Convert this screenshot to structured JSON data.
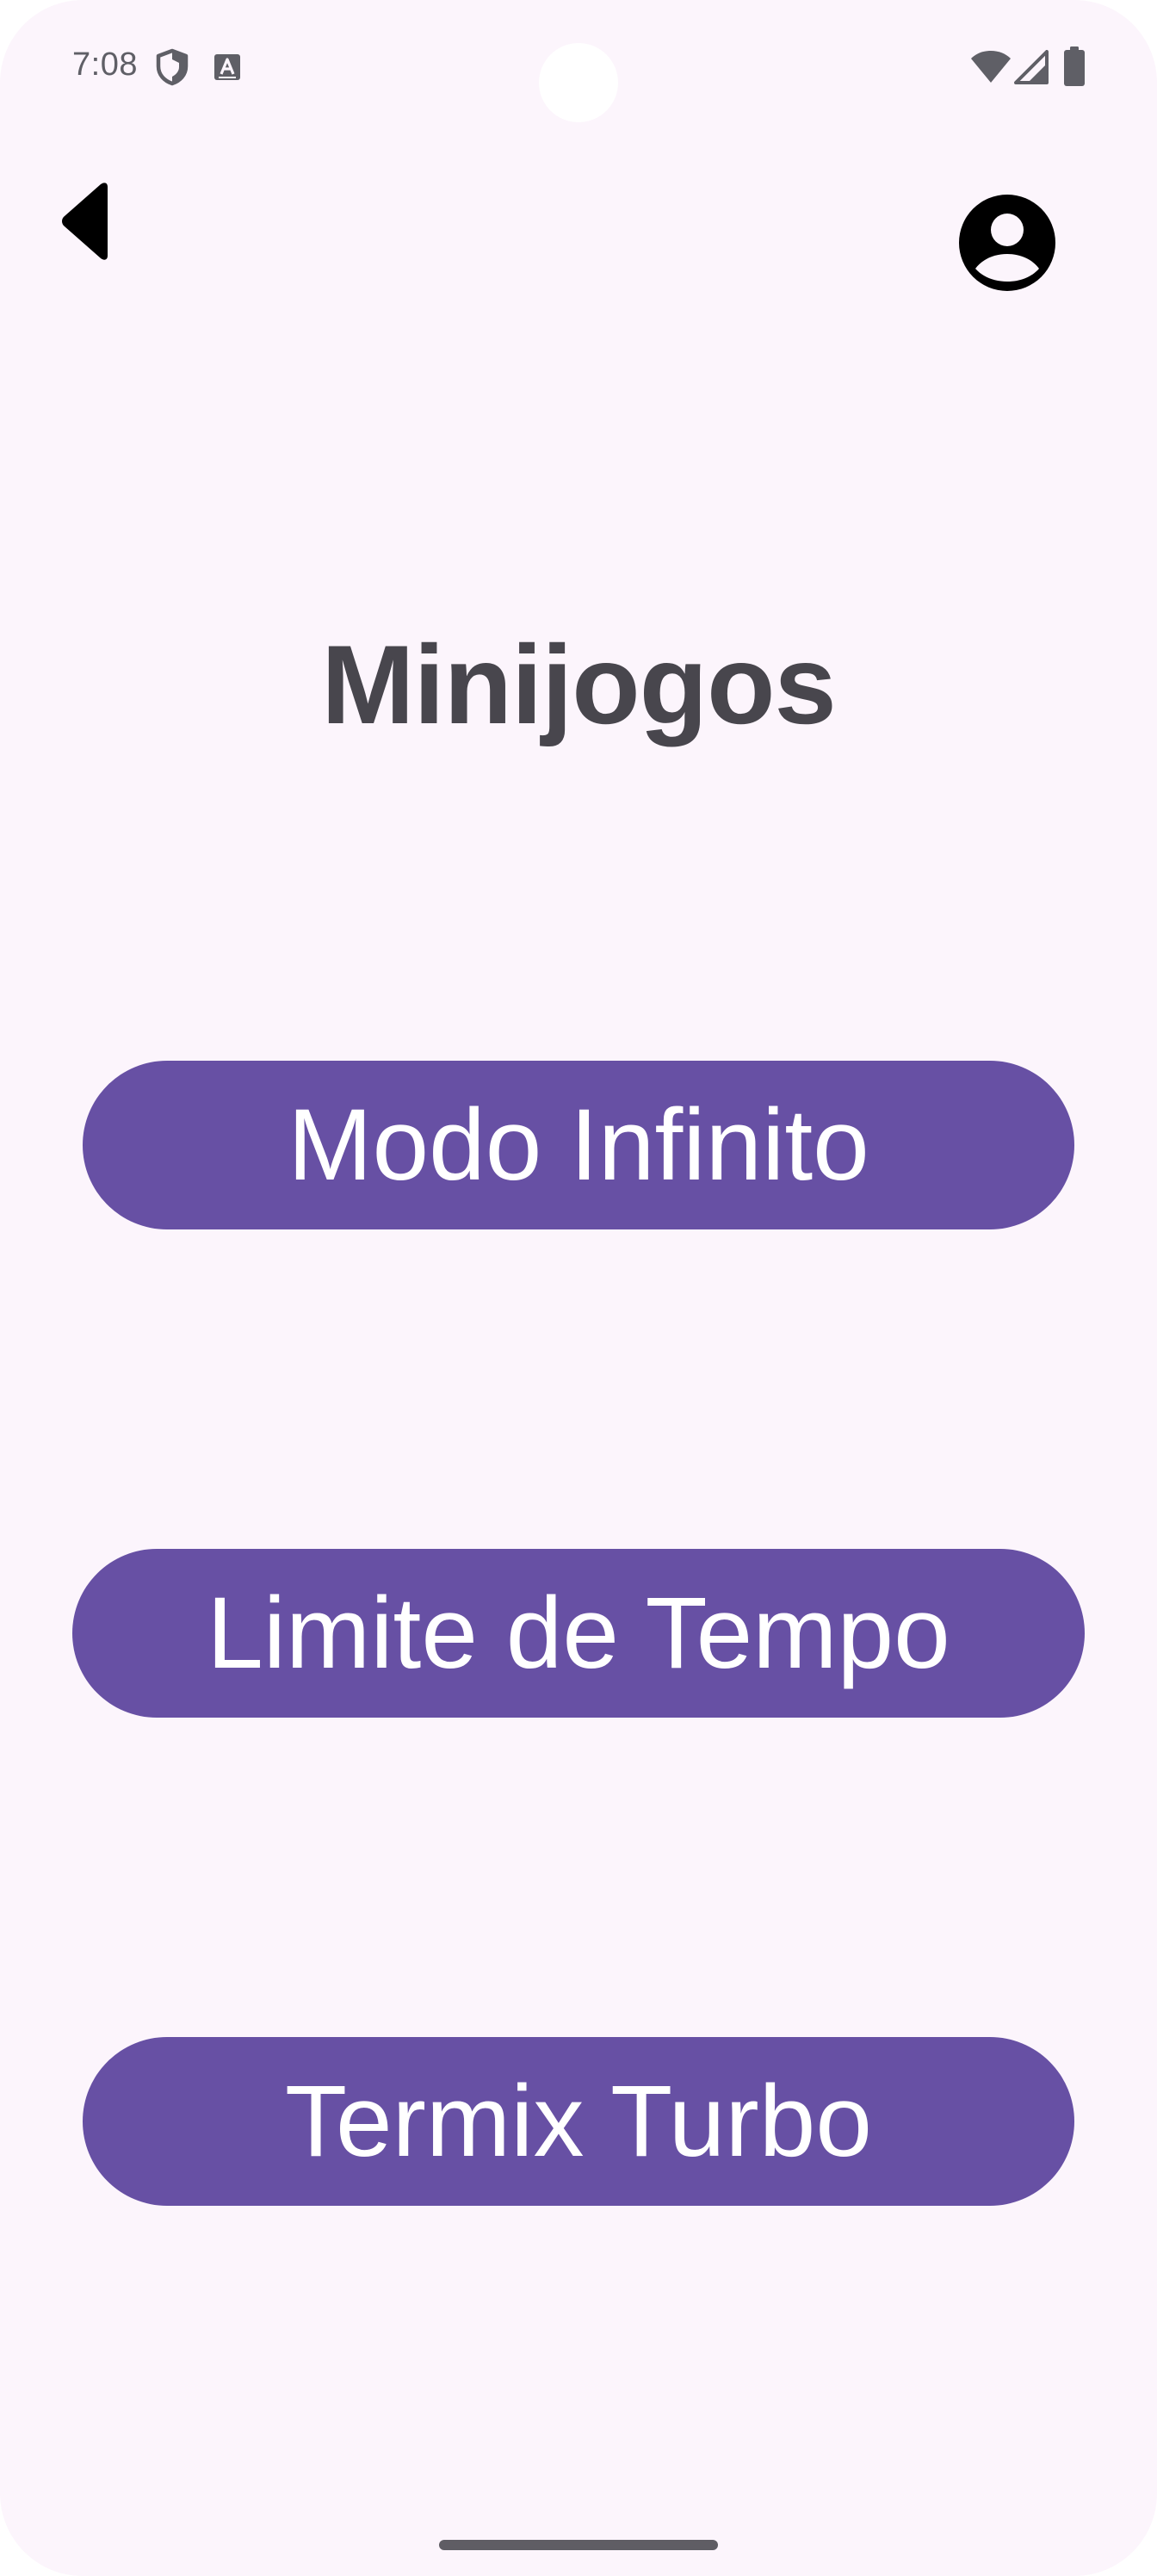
{
  "status_bar": {
    "time": "7:08",
    "icons": [
      "shield-icon",
      "font-a-icon",
      "wifi-icon",
      "cellular-signal-icon",
      "battery-icon"
    ]
  },
  "top_bar": {
    "back_icon": "back-triangle-icon",
    "profile_icon": "account-circle-icon"
  },
  "title": "Minijogos",
  "buttons": [
    {
      "label": "Modo Infinito"
    },
    {
      "label": "Limite de Tempo"
    },
    {
      "label": "Termix Turbo"
    }
  ],
  "colors": {
    "background": "#fcf5fc",
    "primary": "#6750a4",
    "title": "#48464d",
    "on_primary": "#ffffff"
  }
}
